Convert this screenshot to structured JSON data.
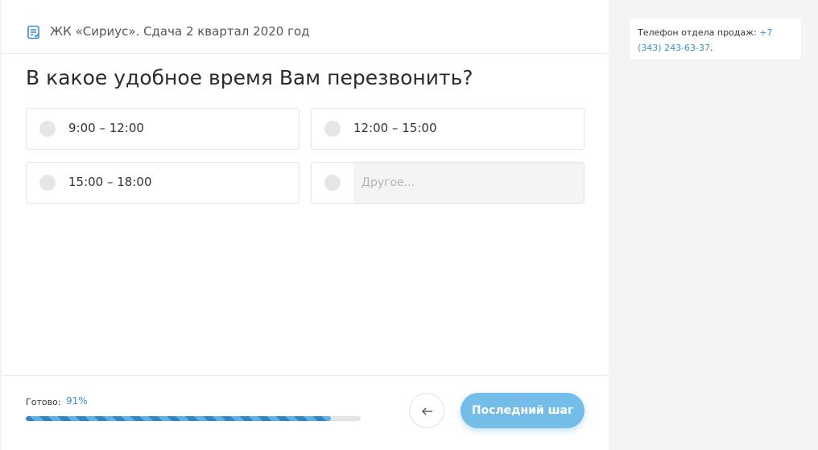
{
  "header": {
    "title": "ЖК «Сириус». Сдача 2 квартал 2020 год",
    "icon": "document-list-icon"
  },
  "question": "В какое удобное время Вам перезвонить?",
  "options": [
    {
      "label": "9:00 – 12:00"
    },
    {
      "label": "12:00 – 15:00"
    },
    {
      "label": "15:00 – 18:00"
    }
  ],
  "other_option": {
    "placeholder": "Другое..."
  },
  "footer": {
    "progress_label": "Готово:",
    "progress_text": "91%",
    "progress_percent": 91,
    "back_icon": "arrow-left-icon",
    "next_label": "Последний шаг"
  },
  "contact": {
    "label": "Телефон отдела продаж:",
    "phone": "+7 (343) 243-63-37",
    "suffix": "."
  },
  "colors": {
    "accent": "#3a8fd4",
    "button": "#75bde9",
    "progress": "#2f86c4"
  }
}
